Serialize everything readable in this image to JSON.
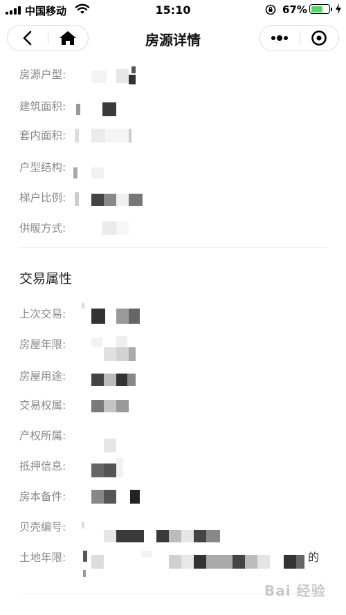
{
  "status_bar": {
    "carrier": "中国移动",
    "time": "15:10",
    "battery": "67%",
    "battery_level": 0.67,
    "battery_color": "#4cd964"
  },
  "nav": {
    "title": "房源详情",
    "back_icon": "chevron-left-icon",
    "home_icon": "home-icon",
    "more_icon": "more-dots-icon",
    "close_icon": "target-circle-icon"
  },
  "house_info": {
    "rows": [
      {
        "label": "房源户型:"
      },
      {
        "label": "建筑面积:"
      },
      {
        "label": "套内面积:"
      },
      {
        "label": "户型结构:"
      },
      {
        "label": "梯户比例:"
      },
      {
        "label": "供暖方式:"
      }
    ]
  },
  "trade_section": {
    "title": "交易属性",
    "rows": [
      {
        "label": "上次交易:"
      },
      {
        "label": "房屋年限:"
      },
      {
        "label": "房屋用途:"
      },
      {
        "label": "交易权属:"
      },
      {
        "label": "产权所属:"
      },
      {
        "label": "抵押信息:"
      },
      {
        "label": "房本备件:"
      },
      {
        "label": "贝壳编号:"
      },
      {
        "label": "土地年限:"
      }
    ],
    "land_suffix": "的"
  },
  "watermark": "Bai 经验"
}
